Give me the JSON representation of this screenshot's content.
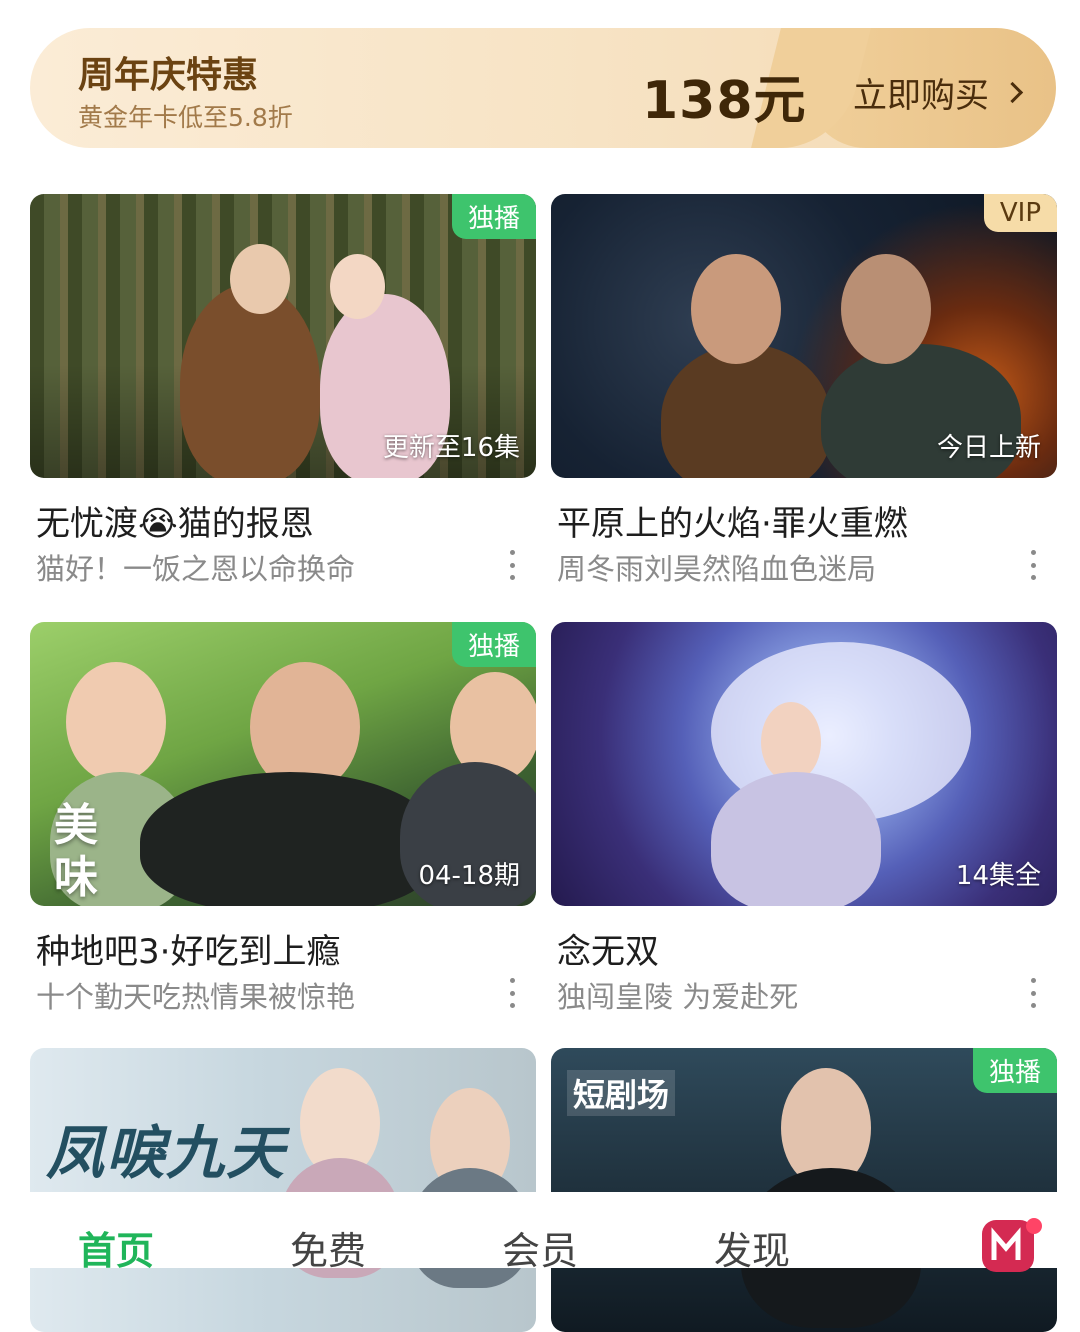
{
  "promo": {
    "title": "周年庆特惠",
    "subtitle": "黄金年卡低至5.8折",
    "price": "138元",
    "cta": "立即购买"
  },
  "cards": [
    {
      "badge": "独播",
      "corner": "更新至16集",
      "title": "无忧渡😭猫的报恩",
      "subtitle": "猫好！一饭之恩以命换命"
    },
    {
      "badge": "VIP",
      "corner": "今日上新",
      "title": "平原上的火焰·罪火重燃",
      "subtitle": "周冬雨刘昊然陷血色迷局"
    },
    {
      "badge": "独播",
      "corner": "04-18期",
      "art_text": "美味",
      "title": "种地吧3·好吃到上瘾",
      "subtitle": "十个勤天吃热情果被惊艳"
    },
    {
      "badge": "",
      "corner": "14集全",
      "title": "念无双",
      "subtitle": "独闯皇陵  为爱赴死"
    },
    {
      "badge": "",
      "art_text": "凤唳九天",
      "title": "",
      "subtitle": ""
    },
    {
      "badge": "独播",
      "art_text": "短剧场",
      "title": "",
      "subtitle": ""
    }
  ],
  "nav": {
    "home": "首页",
    "free": "免费",
    "member": "会员",
    "discover": "发现"
  },
  "colors": {
    "accent_green": "#20b55a",
    "badge_green": "#3ec46d",
    "promo_gold": "#f0cf9a"
  }
}
